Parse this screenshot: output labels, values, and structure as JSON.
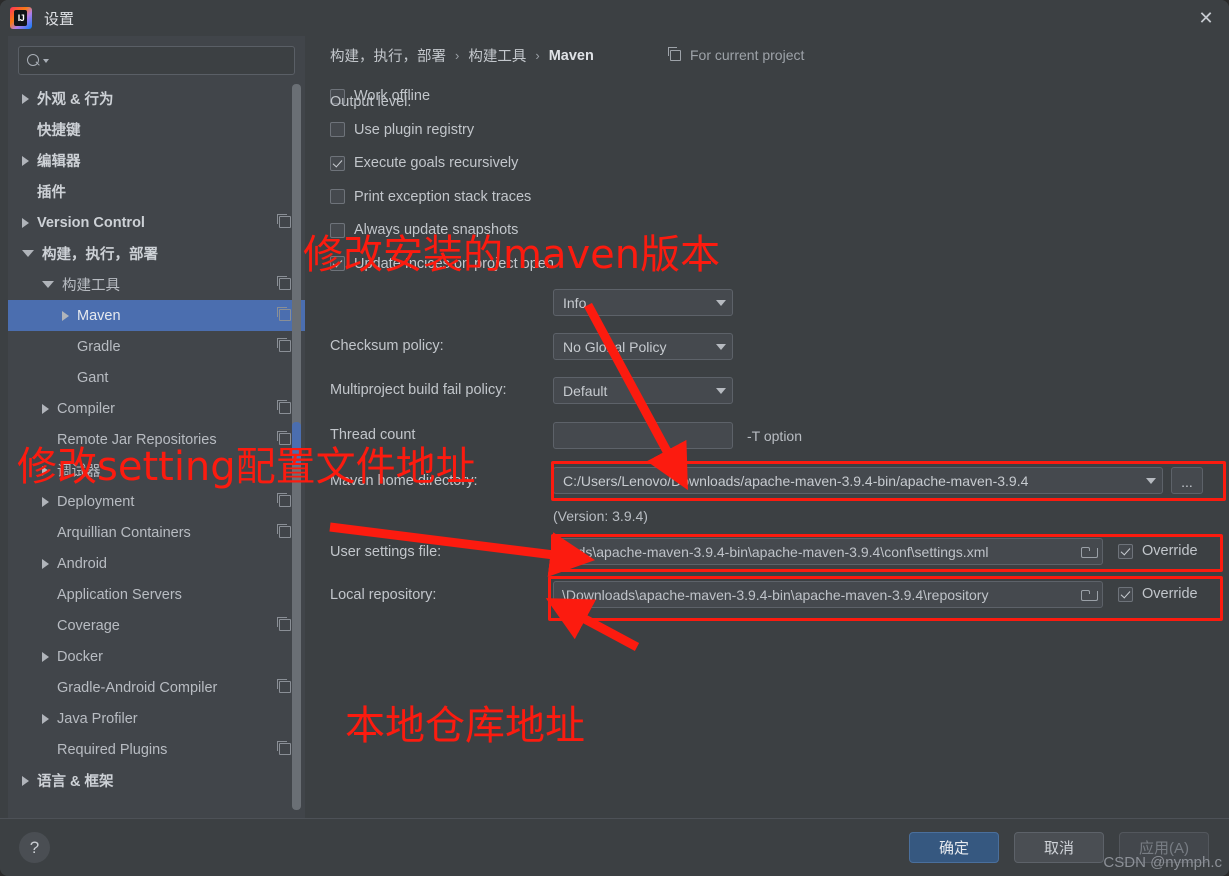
{
  "window": {
    "title": "设置",
    "app_icon": "intellij-idea-icon",
    "close_label": "✕"
  },
  "sidebar": {
    "search": {
      "placeholder": "",
      "value": "",
      "icon": "search-icon"
    },
    "items": [
      {
        "label": "外观 & 行为",
        "arrow": "collapsed",
        "indent": 0,
        "bold": true,
        "copy": false,
        "selected": false
      },
      {
        "label": "快捷键",
        "arrow": "none",
        "indent": 0,
        "bold": true,
        "copy": false,
        "selected": false
      },
      {
        "label": "编辑器",
        "arrow": "collapsed",
        "indent": 0,
        "bold": true,
        "copy": false,
        "selected": false
      },
      {
        "label": "插件",
        "arrow": "none",
        "indent": 0,
        "bold": true,
        "copy": false,
        "selected": false
      },
      {
        "label": "Version Control",
        "arrow": "collapsed",
        "indent": 0,
        "bold": true,
        "copy": true,
        "selected": false
      },
      {
        "label": "构建，执行，部署",
        "arrow": "expanded",
        "indent": 0,
        "bold": true,
        "copy": false,
        "selected": false
      },
      {
        "label": "构建工具",
        "arrow": "expanded",
        "indent": 1,
        "bold": false,
        "copy": true,
        "selected": false
      },
      {
        "label": "Maven",
        "arrow": "collapsed",
        "indent": 2,
        "bold": false,
        "copy": true,
        "selected": true
      },
      {
        "label": "Gradle",
        "arrow": "none",
        "indent": 2,
        "bold": false,
        "copy": true,
        "selected": false
      },
      {
        "label": "Gant",
        "arrow": "none",
        "indent": 2,
        "bold": false,
        "copy": false,
        "selected": false
      },
      {
        "label": "Compiler",
        "arrow": "collapsed",
        "indent": 1,
        "bold": false,
        "copy": true,
        "selected": false
      },
      {
        "label": "Remote Jar Repositories",
        "arrow": "none",
        "indent": 1,
        "bold": false,
        "copy": true,
        "selected": false
      },
      {
        "label": "调试器",
        "arrow": "collapsed",
        "indent": 1,
        "bold": false,
        "copy": false,
        "selected": false
      },
      {
        "label": "Deployment",
        "arrow": "collapsed",
        "indent": 1,
        "bold": false,
        "copy": true,
        "selected": false
      },
      {
        "label": "Arquillian Containers",
        "arrow": "none",
        "indent": 1,
        "bold": false,
        "copy": true,
        "selected": false
      },
      {
        "label": "Android",
        "arrow": "collapsed",
        "indent": 1,
        "bold": false,
        "copy": false,
        "selected": false
      },
      {
        "label": "Application Servers",
        "arrow": "none",
        "indent": 1,
        "bold": false,
        "copy": false,
        "selected": false
      },
      {
        "label": "Coverage",
        "arrow": "none",
        "indent": 1,
        "bold": false,
        "copy": true,
        "selected": false
      },
      {
        "label": "Docker",
        "arrow": "collapsed",
        "indent": 1,
        "bold": false,
        "copy": false,
        "selected": false
      },
      {
        "label": "Gradle-Android Compiler",
        "arrow": "none",
        "indent": 1,
        "bold": false,
        "copy": true,
        "selected": false
      },
      {
        "label": "Java Profiler",
        "arrow": "collapsed",
        "indent": 1,
        "bold": false,
        "copy": false,
        "selected": false
      },
      {
        "label": "Required Plugins",
        "arrow": "none",
        "indent": 1,
        "bold": false,
        "copy": true,
        "selected": false
      },
      {
        "label": "语言 & 框架",
        "arrow": "collapsed",
        "indent": 0,
        "bold": true,
        "copy": false,
        "selected": false
      }
    ]
  },
  "header": {
    "breadcrumb": [
      "构建，执行，部署",
      "构建工具",
      "Maven"
    ],
    "separator": "›",
    "for_current_project": "For current project"
  },
  "main": {
    "checkboxes": [
      {
        "label": "Work offline",
        "checked": false
      },
      {
        "label": "Use plugin registry",
        "checked": false
      },
      {
        "label": "Execute goals recursively",
        "checked": true
      },
      {
        "label": "Print exception stack traces",
        "checked": false
      },
      {
        "label": "Always update snapshots",
        "checked": false
      },
      {
        "label": "Update Incices on project open",
        "checked": true
      }
    ],
    "output_level": {
      "label": "Output level:",
      "value": "Info"
    },
    "checksum_policy": {
      "label": "Checksum policy:",
      "value": "No Global Policy"
    },
    "multiproject_fail_policy": {
      "label": "Multiproject build fail policy:",
      "value": "Default"
    },
    "thread_count": {
      "label": "Thread count",
      "value": "",
      "hint": "-T option"
    },
    "maven_home": {
      "label": "Maven home directory:",
      "value": "C:/Users/Lenovo/Downloads/apache-maven-3.9.4-bin/apache-maven-3.9.4",
      "browse_label": "...",
      "version_note": "(Version: 3.9.4)"
    },
    "user_settings": {
      "label": "User settings file:",
      "value": "oads\\apache-maven-3.9.4-bin\\apache-maven-3.9.4\\conf\\settings.xml",
      "override_label": "Override",
      "override_checked": true
    },
    "local_repository": {
      "label": "Local repository:",
      "value": "\\Downloads\\apache-maven-3.9.4-bin\\apache-maven-3.9.4\\repository",
      "override_label": "Override",
      "override_checked": true
    }
  },
  "footer": {
    "help_label": "?",
    "ok_label": "确定",
    "cancel_label": "取消",
    "apply_label": "应用(A)",
    "watermark": "CSDN @nymph.c"
  },
  "annotations": {
    "color": "#fc1b0f",
    "texts": [
      {
        "text": "修改安装的maven版本"
      },
      {
        "text": "修改setting配置文件地址"
      },
      {
        "text": "本地仓库地址"
      }
    ]
  }
}
